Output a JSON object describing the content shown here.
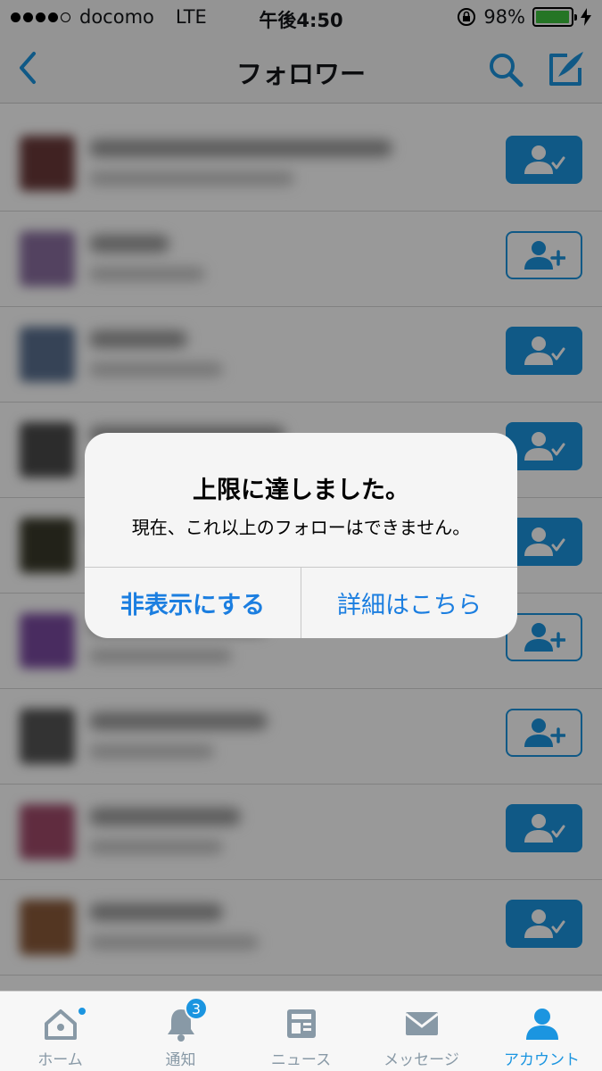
{
  "status_bar": {
    "carrier": "docomo",
    "network": "LTE",
    "time": "午後4:50",
    "battery_percent": "98%",
    "battery_level": 0.98
  },
  "nav": {
    "title": "フォロワー",
    "back_icon": "chevron-left-icon",
    "search_icon": "search-icon",
    "compose_icon": "compose-icon"
  },
  "followers": [
    {
      "avatar_color": "#6b3a3a",
      "name_width": 340,
      "handle_width": 230,
      "button": "following"
    },
    {
      "avatar_color": "#8a6fa0",
      "name_width": 90,
      "handle_width": 130,
      "button": "follow"
    },
    {
      "avatar_color": "#5a7090",
      "name_width": 110,
      "handle_width": 150,
      "button": "following"
    },
    {
      "avatar_color": "#4a4a4a",
      "name_width": 220,
      "handle_width": 180,
      "button": "following"
    },
    {
      "avatar_color": "#3a3a2a",
      "name_width": 260,
      "handle_width": 200,
      "button": "following"
    },
    {
      "avatar_color": "#7a4aa0",
      "name_width": 200,
      "handle_width": 160,
      "button": "follow"
    },
    {
      "avatar_color": "#555555",
      "name_width": 200,
      "handle_width": 140,
      "button": "follow"
    },
    {
      "avatar_color": "#a04a6a",
      "name_width": 170,
      "handle_width": 150,
      "button": "following"
    },
    {
      "avatar_color": "#8a5a3a",
      "name_width": 150,
      "handle_width": 190,
      "button": "following"
    }
  ],
  "alert": {
    "title": "上限に達しました。",
    "message": "現在、これ以上のフォローはできません。",
    "dismiss_label": "非表示にする",
    "details_label": "詳細はこちら"
  },
  "tabs": [
    {
      "label": "ホーム",
      "icon": "home-icon"
    },
    {
      "label": "通知",
      "icon": "bell-icon",
      "badge": "3"
    },
    {
      "label": "ニュース",
      "icon": "news-icon"
    },
    {
      "label": "メッセージ",
      "icon": "envelope-icon"
    },
    {
      "label": "アカウント",
      "icon": "person-icon",
      "active": true
    }
  ],
  "colors": {
    "accent": "#1b95e0",
    "battery": "#3ec43e",
    "alert_link": "#1b7ee0"
  }
}
